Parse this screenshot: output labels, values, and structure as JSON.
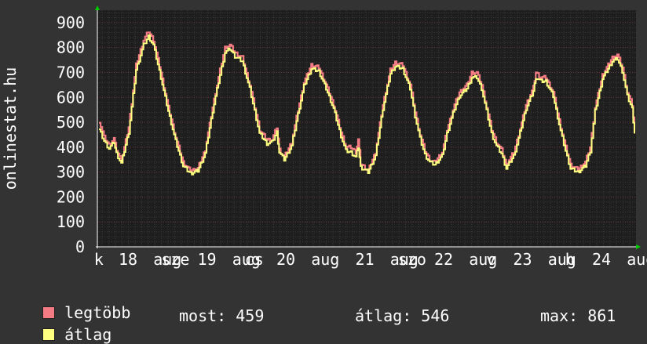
{
  "chart_data": {
    "type": "line",
    "ylabel": "onlinestat.hu",
    "ylim": [
      0,
      950
    ],
    "yticks": [
      0,
      100,
      200,
      300,
      400,
      500,
      600,
      700,
      800,
      900
    ],
    "xlim": [
      0,
      6.9
    ],
    "xticks": [
      {
        "x": -0.37,
        "label": "k"
      },
      {
        "x": 0.0,
        "label": "18"
      },
      {
        "x": 0.5,
        "label": "aug"
      },
      {
        "x": 0.6,
        "label": "sze"
      },
      {
        "x": 1.0,
        "label": "19"
      },
      {
        "x": 1.5,
        "label": "aug"
      },
      {
        "x": 1.6,
        "label": "cs"
      },
      {
        "x": 2.0,
        "label": "20"
      },
      {
        "x": 2.5,
        "label": "aug"
      },
      {
        "x": 3.0,
        "label": "21"
      },
      {
        "x": 3.5,
        "label": "aug"
      },
      {
        "x": 3.6,
        "label": "szo"
      },
      {
        "x": 4.0,
        "label": "22"
      },
      {
        "x": 4.5,
        "label": "aug"
      },
      {
        "x": 4.6,
        "label": "v"
      },
      {
        "x": 5.0,
        "label": "23"
      },
      {
        "x": 5.5,
        "label": "aug"
      },
      {
        "x": 5.6,
        "label": "h"
      },
      {
        "x": 6.0,
        "label": "24"
      },
      {
        "x": 6.5,
        "label": "aug"
      }
    ],
    "grid": true,
    "legend_position": "bottom-left",
    "series": [
      {
        "name": "legtöbb",
        "color": "#f27b84",
        "anchors": [
          [
            0,
            505
          ],
          [
            0.1,
            440
          ],
          [
            0.2,
            410
          ],
          [
            0.3,
            435
          ],
          [
            0.35,
            390
          ],
          [
            0.45,
            345
          ],
          [
            0.6,
            480
          ],
          [
            0.75,
            730
          ],
          [
            0.9,
            830
          ],
          [
            1.0,
            865
          ],
          [
            1.1,
            830
          ],
          [
            1.25,
            700
          ],
          [
            1.4,
            560
          ],
          [
            1.55,
            440
          ],
          [
            1.7,
            340
          ],
          [
            1.85,
            305
          ],
          [
            2.0,
            315
          ],
          [
            2.15,
            390
          ],
          [
            2.3,
            560
          ],
          [
            2.45,
            710
          ],
          [
            2.55,
            800
          ],
          [
            2.65,
            810
          ],
          [
            2.75,
            780
          ],
          [
            2.9,
            760
          ],
          [
            3.05,
            650
          ],
          [
            3.15,
            560
          ],
          [
            3.25,
            470
          ],
          [
            3.4,
            430
          ],
          [
            3.5,
            430
          ],
          [
            3.6,
            480
          ],
          [
            3.65,
            390
          ],
          [
            3.75,
            360
          ],
          [
            3.9,
            420
          ],
          [
            4.0,
            520
          ],
          [
            4.15,
            660
          ],
          [
            4.3,
            730
          ],
          [
            4.45,
            720
          ],
          [
            4.6,
            650
          ],
          [
            4.75,
            570
          ],
          [
            4.9,
            460
          ],
          [
            5.0,
            400
          ],
          [
            5.1,
            400
          ],
          [
            5.2,
            380
          ],
          [
            5.25,
            430
          ],
          [
            5.3,
            335
          ],
          [
            5.45,
            305
          ],
          [
            5.6,
            380
          ],
          [
            5.75,
            570
          ],
          [
            5.9,
            710
          ],
          [
            6.0,
            740
          ],
          [
            6.15,
            730
          ],
          [
            6.3,
            650
          ],
          [
            6.4,
            540
          ],
          [
            6.5,
            450
          ],
          [
            6.6,
            385
          ],
          [
            6.7,
            350
          ],
          [
            6.8,
            340
          ],
          [
            6.95,
            380
          ],
          [
            7.05,
            470
          ],
          [
            7.2,
            570
          ],
          [
            7.3,
            620
          ],
          [
            7.45,
            650
          ],
          [
            7.55,
            700
          ],
          [
            7.65,
            700
          ],
          [
            7.75,
            650
          ],
          [
            7.85,
            560
          ],
          [
            7.95,
            470
          ],
          [
            8.05,
            420
          ],
          [
            8.15,
            390
          ],
          [
            8.25,
            330
          ],
          [
            8.4,
            380
          ],
          [
            8.5,
            450
          ],
          [
            8.65,
            570
          ],
          [
            8.8,
            640
          ],
          [
            8.85,
            700
          ],
          [
            8.95,
            680
          ],
          [
            9.05,
            680
          ],
          [
            9.2,
            620
          ],
          [
            9.35,
            480
          ],
          [
            9.45,
            400
          ],
          [
            9.55,
            330
          ],
          [
            9.7,
            310
          ],
          [
            9.85,
            340
          ],
          [
            9.95,
            400
          ],
          [
            10.05,
            560
          ],
          [
            10.2,
            690
          ],
          [
            10.4,
            760
          ],
          [
            10.5,
            770
          ],
          [
            10.6,
            720
          ],
          [
            10.7,
            620
          ],
          [
            10.8,
            570
          ],
          [
            10.85,
            470
          ]
        ]
      },
      {
        "name": "átlag",
        "color": "#ffff80",
        "anchors": [
          [
            0,
            470
          ],
          [
            0.1,
            425
          ],
          [
            0.2,
            395
          ],
          [
            0.3,
            420
          ],
          [
            0.35,
            375
          ],
          [
            0.45,
            335
          ],
          [
            0.6,
            460
          ],
          [
            0.75,
            710
          ],
          [
            0.9,
            810
          ],
          [
            1.0,
            845
          ],
          [
            1.1,
            810
          ],
          [
            1.25,
            680
          ],
          [
            1.4,
            545
          ],
          [
            1.55,
            425
          ],
          [
            1.7,
            325
          ],
          [
            1.85,
            295
          ],
          [
            2.0,
            305
          ],
          [
            2.15,
            375
          ],
          [
            2.3,
            545
          ],
          [
            2.45,
            690
          ],
          [
            2.55,
            780
          ],
          [
            2.65,
            795
          ],
          [
            2.75,
            765
          ],
          [
            2.9,
            745
          ],
          [
            3.05,
            635
          ],
          [
            3.15,
            545
          ],
          [
            3.25,
            455
          ],
          [
            3.4,
            415
          ],
          [
            3.5,
            420
          ],
          [
            3.6,
            460
          ],
          [
            3.65,
            380
          ],
          [
            3.75,
            350
          ],
          [
            3.9,
            405
          ],
          [
            4.0,
            505
          ],
          [
            4.15,
            645
          ],
          [
            4.3,
            715
          ],
          [
            4.45,
            705
          ],
          [
            4.6,
            635
          ],
          [
            4.75,
            555
          ],
          [
            4.9,
            445
          ],
          [
            5.0,
            385
          ],
          [
            5.1,
            380
          ],
          [
            5.2,
            360
          ],
          [
            5.25,
            400
          ],
          [
            5.3,
            320
          ],
          [
            5.45,
            300
          ],
          [
            5.6,
            365
          ],
          [
            5.75,
            555
          ],
          [
            5.9,
            695
          ],
          [
            6.0,
            725
          ],
          [
            6.15,
            715
          ],
          [
            6.3,
            635
          ],
          [
            6.4,
            525
          ],
          [
            6.5,
            435
          ],
          [
            6.6,
            370
          ],
          [
            6.7,
            340
          ],
          [
            6.8,
            330
          ],
          [
            6.95,
            365
          ],
          [
            7.05,
            455
          ],
          [
            7.2,
            555
          ],
          [
            7.3,
            605
          ],
          [
            7.45,
            635
          ],
          [
            7.55,
            680
          ],
          [
            7.65,
            680
          ],
          [
            7.75,
            635
          ],
          [
            7.85,
            545
          ],
          [
            7.95,
            455
          ],
          [
            8.05,
            405
          ],
          [
            8.15,
            375
          ],
          [
            8.25,
            315
          ],
          [
            8.4,
            365
          ],
          [
            8.5,
            435
          ],
          [
            8.65,
            555
          ],
          [
            8.8,
            625
          ],
          [
            8.85,
            680
          ],
          [
            8.95,
            665
          ],
          [
            9.05,
            665
          ],
          [
            9.2,
            605
          ],
          [
            9.35,
            465
          ],
          [
            9.45,
            385
          ],
          [
            9.55,
            315
          ],
          [
            9.7,
            300
          ],
          [
            9.85,
            325
          ],
          [
            9.95,
            385
          ],
          [
            10.05,
            545
          ],
          [
            10.2,
            675
          ],
          [
            10.4,
            745
          ],
          [
            10.5,
            755
          ],
          [
            10.6,
            705
          ],
          [
            10.7,
            605
          ],
          [
            10.8,
            555
          ],
          [
            10.85,
            455
          ]
        ]
      }
    ]
  },
  "stats": {
    "most_label": "most:",
    "most_value": "459",
    "atlag_label": "átlag:",
    "atlag_value": "546",
    "max_label": "max:",
    "max_value": "861"
  }
}
